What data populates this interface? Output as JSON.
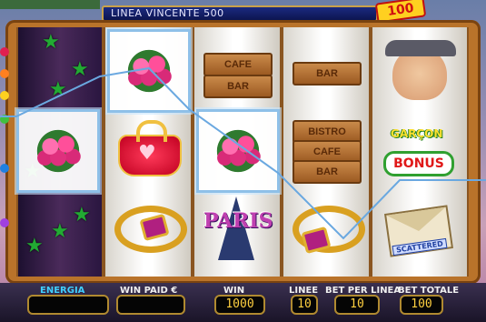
{
  "header": {
    "winning_line": "LINEA VINCENTE 500",
    "badge": "100"
  },
  "reels": {
    "reel2_top": "rose-bouquet",
    "reel2_middle": "red-purse",
    "reel2_bottom": "gold-ring",
    "reel1_middle": "rose-bouquet",
    "reel3_top_plank_1": "CAFE",
    "reel3_top_plank_2": "BAR",
    "reel3_middle": "rose-bouquet",
    "reel3_bottom_label": "PARIS",
    "reel4_top_plank": "BAR",
    "reel4_mid_plank_1": "BISTRO",
    "reel4_mid_plank_2": "CAFE",
    "reel4_mid_plank_3": "BAR",
    "reel4_bottom": "gold-ring",
    "reel5_top": "waiter-face",
    "reel5_middle_title": "GARÇON",
    "reel5_middle_bonus": "BONUS",
    "reel5_bottom_scatter": "SCATTERED"
  },
  "panel": {
    "energia_label": "ENERGIA",
    "energia_value": "",
    "win_paid_label": "WIN PAID €",
    "win_paid_value": "",
    "win_label": "WIN",
    "win_value": "1000",
    "linee_label": "LINEE",
    "linee_value": "10",
    "bet_per_linea_label": "BET PER LINEA",
    "bet_per_linea_value": "10",
    "bet_totale_label": "BET TOTALE",
    "bet_totale_value": "100"
  },
  "colors": {
    "reel_frame": "#b9732a",
    "highlight_border": "#8ec0e8",
    "payline": "#6aa8e0",
    "panel_digits": "#ffd040"
  }
}
